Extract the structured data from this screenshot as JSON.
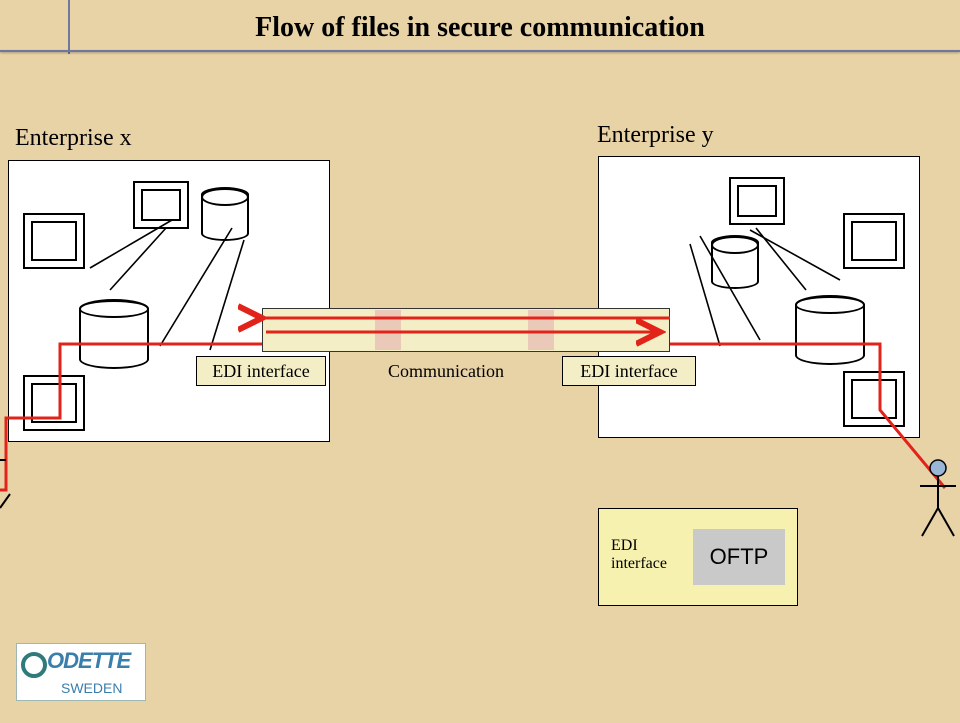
{
  "title": "Flow of files in secure communication",
  "enterprise_x_label": "Enterprise x",
  "enterprise_y_label": "Enterprise y",
  "edi_left": "EDI interface",
  "comm_label": "Communication",
  "edi_right": "EDI interface",
  "oftp_edi_label": "EDI\ninterface",
  "oftp_label": "OFTP",
  "logo_brand": "ODETTE",
  "logo_region": "SWEDEN"
}
